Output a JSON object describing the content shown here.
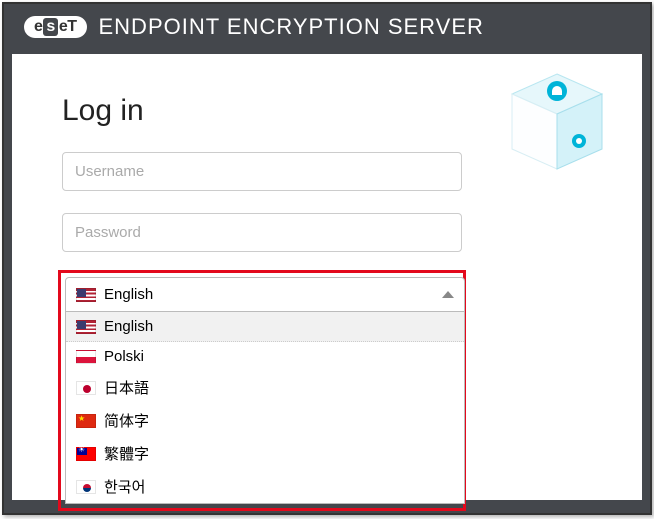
{
  "header": {
    "brand_parts": [
      "e",
      "s",
      "e",
      "T"
    ],
    "title": "ENDPOINT ENCRYPTION SERVER"
  },
  "login": {
    "title": "Log in",
    "username_placeholder": "Username",
    "password_placeholder": "Password"
  },
  "language": {
    "selected_label": "English",
    "selected_flag": "us",
    "options": [
      {
        "label": "English",
        "flag": "us",
        "selected": true
      },
      {
        "label": "Polski",
        "flag": "pl",
        "selected": false
      },
      {
        "label": "日本語",
        "flag": "jp",
        "selected": false
      },
      {
        "label": "简体字",
        "flag": "cn",
        "selected": false
      },
      {
        "label": "繁體字",
        "flag": "tw",
        "selected": false
      },
      {
        "label": "한국어",
        "flag": "kr",
        "selected": false
      }
    ]
  }
}
